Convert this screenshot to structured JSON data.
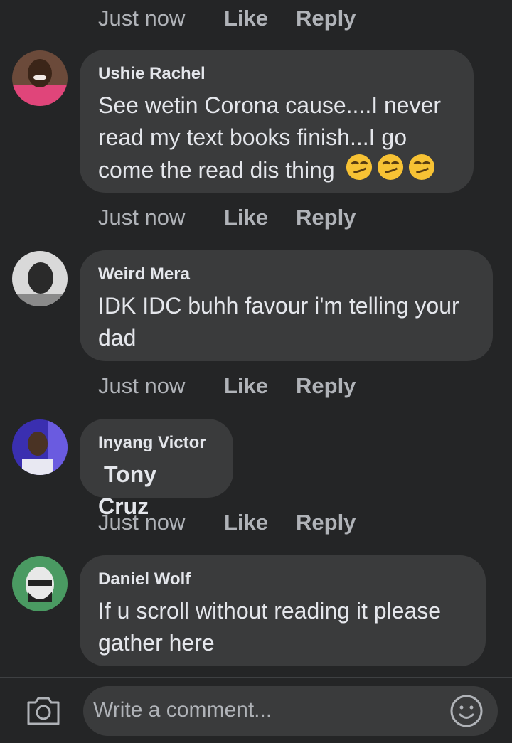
{
  "top_meta": {
    "time": "Just now",
    "like": "Like",
    "reply": "Reply"
  },
  "comments": [
    {
      "author": "Ushie Rachel",
      "lines": [
        "See wetin Corona cause....I never",
        "read my text books finish...I go",
        "come the read dis thing"
      ],
      "emoji": "smirk-emoji",
      "meta": {
        "time": "Just now",
        "like": "Like",
        "reply": "Reply"
      }
    },
    {
      "author": "Weird Mera",
      "lines": [
        "IDK IDC buhh favour i'm telling your",
        "dad"
      ],
      "meta": {
        "time": "Just now",
        "like": "Like",
        "reply": "Reply"
      }
    },
    {
      "author": "Inyang Victor",
      "tag": "Tony Cruz",
      "meta": {
        "time": "Just now",
        "like": "Like",
        "reply": "Reply"
      }
    },
    {
      "author": "Daniel Wolf",
      "lines": [
        "If u scroll without reading it please",
        "gather here"
      ]
    }
  ],
  "composer": {
    "placeholder": "Write a comment..."
  },
  "icons": {
    "camera": "camera-icon",
    "emoji": "emoji-smile-icon"
  },
  "colors": {
    "background": "#242526",
    "bubble": "#3a3b3c",
    "text": "#e4e6eb",
    "muted": "#b0b3b8"
  }
}
